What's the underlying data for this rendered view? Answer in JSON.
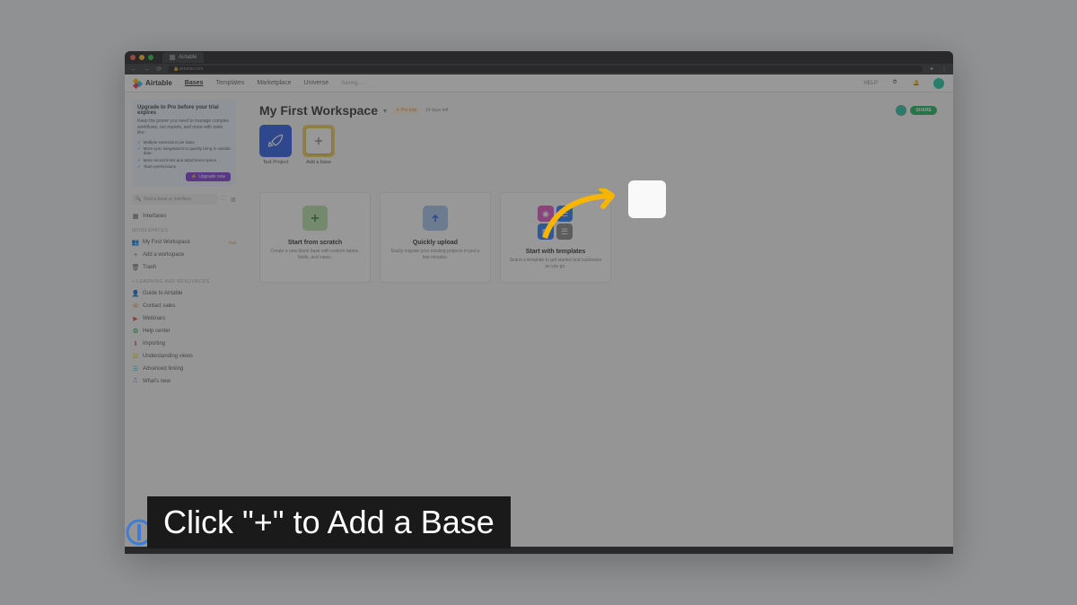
{
  "browser": {
    "tab_title": "Airtable",
    "url": "airtable.com"
  },
  "topnav": {
    "logo": "Airtable",
    "links": [
      "Bases",
      "Templates",
      "Marketplace",
      "Universe"
    ],
    "saving": "Saving...",
    "help": "HELP"
  },
  "upgrade": {
    "title": "Upgrade to Pro before your trial expires",
    "desc": "Keep the power you need to manage complex workflows, run reports, and more with tools like:",
    "features": [
      "Multiple extensions per base",
      "More sync integrations to quickly bring in outside data",
      "More record limits and attachment space",
      "Team permissions"
    ],
    "button": "Upgrade now"
  },
  "sidebar": {
    "search_placeholder": "Find a base or interface",
    "interfaces": "Interfaces",
    "workspaces_header": "WORKSPACES",
    "workspace": "My First Workspace",
    "trial_tag": "Trial",
    "add_workspace": "Add a workspace",
    "trash": "Trash",
    "learning_header": "+ LEARNING AND RESOURCES",
    "resources": [
      {
        "label": "Guide to Airtable",
        "color": "#f7b73b",
        "icon": "person"
      },
      {
        "label": "Contact sales",
        "color": "#e67e22",
        "icon": "mail"
      },
      {
        "label": "Webinars",
        "color": "#e74c3c",
        "icon": "play"
      },
      {
        "label": "Help center",
        "color": "#1bb85c",
        "icon": "help"
      },
      {
        "label": "Importing",
        "color": "#e056c4",
        "icon": "import"
      },
      {
        "label": "Understanding views",
        "color": "#f39c12",
        "icon": "views"
      },
      {
        "label": "Advanced linking",
        "color": "#4db8d8",
        "icon": "link"
      },
      {
        "label": "What's new",
        "color": "#7d3cdb",
        "icon": "gift"
      }
    ]
  },
  "workspace": {
    "title": "My First Workspace",
    "badge": "✦ Pro trial",
    "days": "14 days left",
    "share": "SHARE"
  },
  "bases": [
    {
      "label": "Test Project",
      "color": "#2d5ce6",
      "icon": "rocket"
    },
    {
      "label": "Add a base",
      "type": "add"
    }
  ],
  "cards": [
    {
      "title": "Start from scratch",
      "desc": "Create a new blank base with custom tables, fields, and views.",
      "tile_color": "#b7e0a8",
      "icon": "plus"
    },
    {
      "title": "Quickly upload",
      "desc": "Easily migrate your existing projects in just a few minutes.",
      "tile_color": "#a8c5f0",
      "icon": "up"
    },
    {
      "title": "Start with templates",
      "desc": "Select a template to get started and customize as you go.",
      "type": "grid"
    }
  ],
  "caption": "Click \"+\" to Add a Base"
}
